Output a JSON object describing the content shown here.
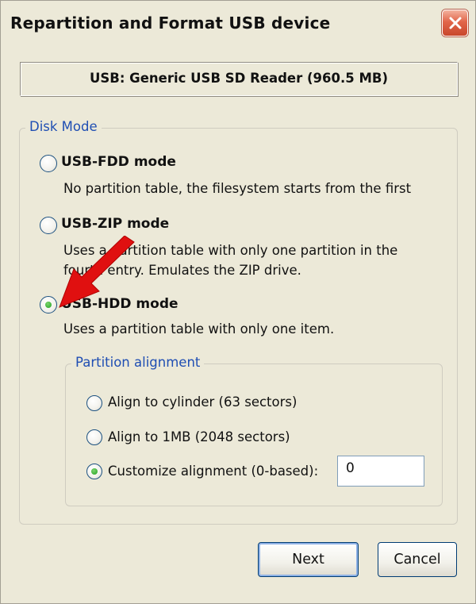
{
  "window": {
    "title": "Repartition and Format USB device"
  },
  "device": {
    "label": "USB: Generic USB  SD Reader (960.5 MB)"
  },
  "disk_mode": {
    "legend": "Disk Mode",
    "options": [
      {
        "label": "USB-FDD mode",
        "description": "No partition table, the filesystem starts from the first",
        "checked": false
      },
      {
        "label": "USB-ZIP mode",
        "description_line1": "Uses a partition table with only one partition in the",
        "description_line2": "fourth entry. Emulates the ZIP drive.",
        "checked": false
      },
      {
        "label": "USB-HDD mode",
        "description": "Uses a partition table with only one item.",
        "checked": true
      }
    ]
  },
  "partition_alignment": {
    "legend": "Partition alignment",
    "options": [
      {
        "label": "Align to cylinder (63 sectors)",
        "checked": false
      },
      {
        "label": "Align to 1MB (2048 sectors)",
        "checked": false
      },
      {
        "label": "Customize alignment (0-based):",
        "checked": true
      }
    ],
    "custom_value": "0"
  },
  "buttons": {
    "next": "Next",
    "cancel": "Cancel"
  },
  "icons": {
    "close": "close-icon",
    "annotation": "red-arrow-icon"
  },
  "colors": {
    "legend": "#1f4eb3",
    "close_button": "#e2664a",
    "arrow": "#e01010",
    "radio_dot": "#21a121"
  }
}
